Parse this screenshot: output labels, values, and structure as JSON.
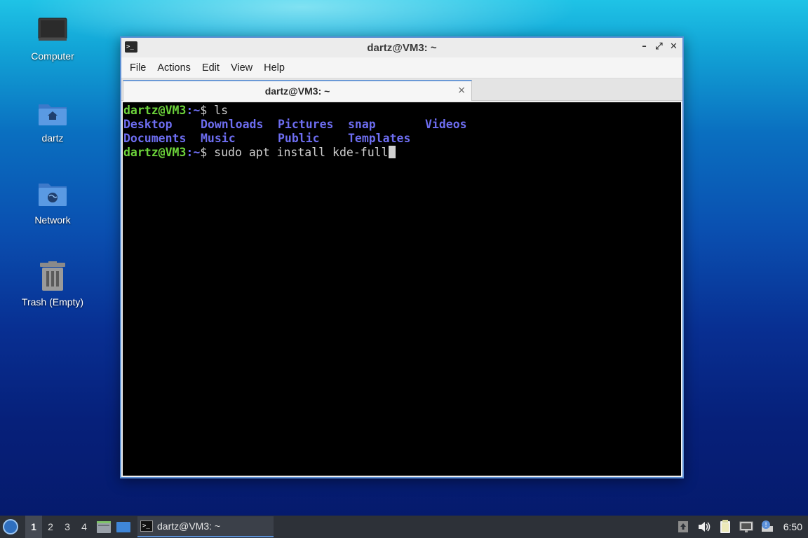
{
  "desktop": {
    "icons": [
      {
        "label": "Computer"
      },
      {
        "label": "dartz"
      },
      {
        "label": "Network"
      },
      {
        "label": "Trash (Empty)"
      }
    ]
  },
  "window": {
    "title": "dartz@VM3: ~",
    "menu": [
      "File",
      "Actions",
      "Edit",
      "View",
      "Help"
    ],
    "tab": {
      "title": "dartz@VM3: ~",
      "close": "×"
    },
    "controls": {
      "minimize": "–",
      "maximize": "⤢",
      "close": "✕"
    }
  },
  "terminal": {
    "user_host": "dartz@VM3",
    "path": ":~",
    "prompt_symbol": "$",
    "command1": " ls",
    "ls_row1": [
      "Desktop",
      "Downloads",
      "Pictures",
      "snap",
      "Videos"
    ],
    "ls_row2": [
      "Documents",
      "Music",
      "Public",
      "Templates"
    ],
    "command2": " sudo apt install kde-full"
  },
  "taskbar": {
    "workspaces": [
      "1",
      "2",
      "3",
      "4"
    ],
    "active_workspace": "1",
    "task_title": "dartz@VM3: ~",
    "clock": "6:50"
  },
  "colors": {
    "prompt_user": "#6cd23a",
    "directory": "#6d6df0",
    "terminal_bg": "#000000",
    "window_border": "#5b8fd4"
  }
}
